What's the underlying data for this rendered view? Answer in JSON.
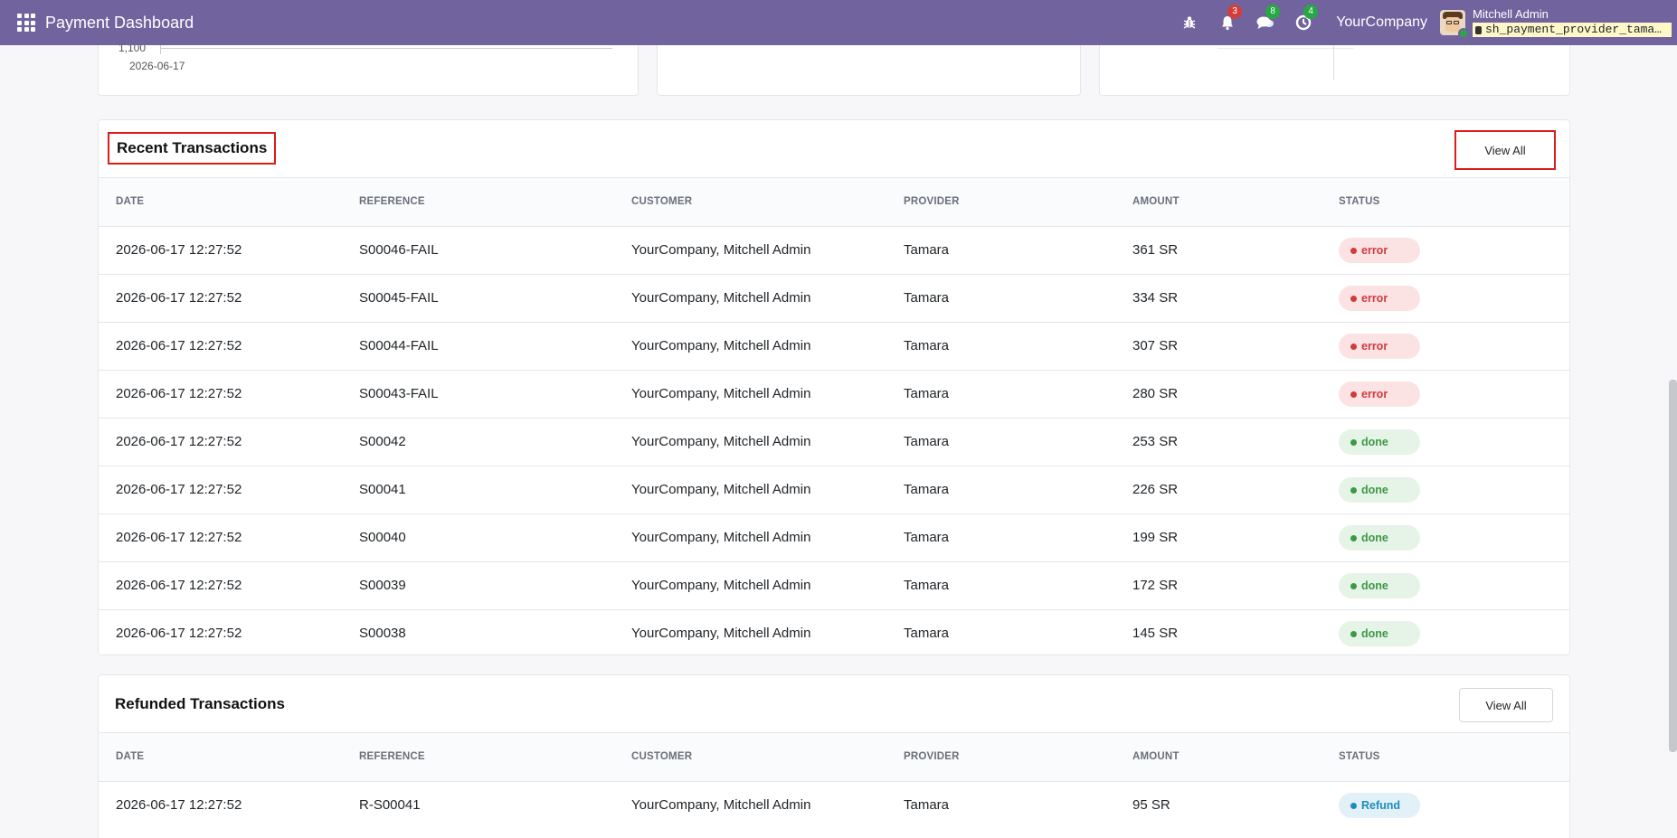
{
  "navbar": {
    "title": "Payment Dashboard",
    "company": "YourCompany",
    "user_name": "Mitchell Admin",
    "database": "sh_payment_provider_tama…",
    "badges": {
      "activity": "3",
      "messages": "8",
      "timer": "4"
    }
  },
  "top_chart": {
    "y_tick": "1,100",
    "x_tick": "2026-06-17"
  },
  "recent": {
    "title": "Recent Transactions",
    "view_all": "View All",
    "columns": [
      "DATE",
      "REFERENCE",
      "CUSTOMER",
      "PROVIDER",
      "AMOUNT",
      "STATUS"
    ],
    "rows": [
      {
        "date": "2026-06-17 12:27:52",
        "reference": "S00046-FAIL",
        "customer": "YourCompany, Mitchell Admin",
        "provider": "Tamara",
        "amount": "361 SR",
        "status": "error"
      },
      {
        "date": "2026-06-17 12:27:52",
        "reference": "S00045-FAIL",
        "customer": "YourCompany, Mitchell Admin",
        "provider": "Tamara",
        "amount": "334 SR",
        "status": "error"
      },
      {
        "date": "2026-06-17 12:27:52",
        "reference": "S00044-FAIL",
        "customer": "YourCompany, Mitchell Admin",
        "provider": "Tamara",
        "amount": "307 SR",
        "status": "error"
      },
      {
        "date": "2026-06-17 12:27:52",
        "reference": "S00043-FAIL",
        "customer": "YourCompany, Mitchell Admin",
        "provider": "Tamara",
        "amount": "280 SR",
        "status": "error"
      },
      {
        "date": "2026-06-17 12:27:52",
        "reference": "S00042",
        "customer": "YourCompany, Mitchell Admin",
        "provider": "Tamara",
        "amount": "253 SR",
        "status": "done"
      },
      {
        "date": "2026-06-17 12:27:52",
        "reference": "S00041",
        "customer": "YourCompany, Mitchell Admin",
        "provider": "Tamara",
        "amount": "226 SR",
        "status": "done"
      },
      {
        "date": "2026-06-17 12:27:52",
        "reference": "S00040",
        "customer": "YourCompany, Mitchell Admin",
        "provider": "Tamara",
        "amount": "199 SR",
        "status": "done"
      },
      {
        "date": "2026-06-17 12:27:52",
        "reference": "S00039",
        "customer": "YourCompany, Mitchell Admin",
        "provider": "Tamara",
        "amount": "172 SR",
        "status": "done"
      },
      {
        "date": "2026-06-17 12:27:52",
        "reference": "S00038",
        "customer": "YourCompany, Mitchell Admin",
        "provider": "Tamara",
        "amount": "145 SR",
        "status": "done"
      }
    ]
  },
  "refunded": {
    "title": "Refunded Transactions",
    "view_all": "View All",
    "columns": [
      "DATE",
      "REFERENCE",
      "CUSTOMER",
      "PROVIDER",
      "AMOUNT",
      "STATUS"
    ],
    "rows": [
      {
        "date": "2026-06-17 12:27:52",
        "reference": "R-S00041",
        "customer": "YourCompany, Mitchell Admin",
        "provider": "Tamara",
        "amount": "95 SR",
        "status": "Refund"
      }
    ]
  },
  "status_colors": {
    "error": "#d3393d",
    "done": "#3a9a47",
    "Refund": "#1d8cbd"
  },
  "accent": "#71639e"
}
